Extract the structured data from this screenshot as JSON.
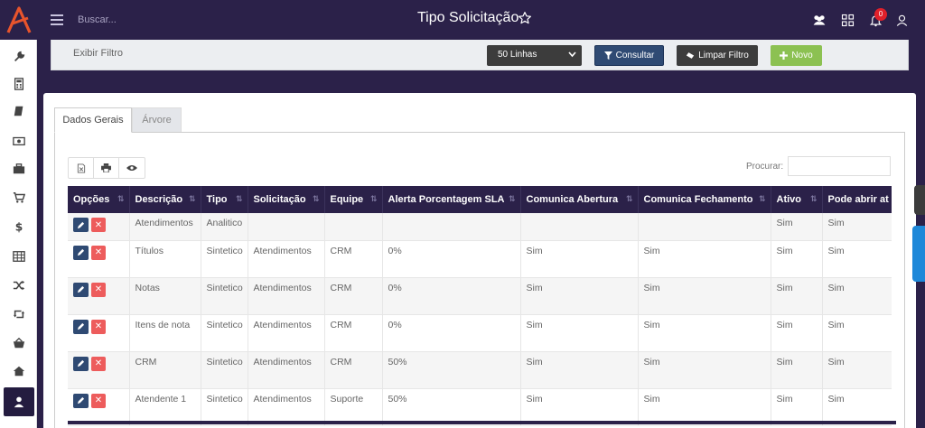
{
  "header": {
    "search_placeholder": "Buscar...",
    "page_title": "Tipo Solicitação",
    "notification_count": "0"
  },
  "sidebar": {
    "items": [
      "wrench-icon",
      "calculator-icon",
      "book-icon",
      "money-icon",
      "briefcase-icon",
      "cart-icon",
      "dollar-icon",
      "table-icon",
      "shuffle-icon",
      "retweet-icon",
      "basket-icon",
      "home-icon",
      "user-icon"
    ],
    "active": "user-icon"
  },
  "filterbar": {
    "label": "Exibir Filtro",
    "rows_select": "50 Linhas",
    "consultar": "Consultar",
    "limpar": "Limpar Filtro",
    "novo": "Novo"
  },
  "tabs": {
    "geral": "Dados Gerais",
    "arvore": "Árvore"
  },
  "table": {
    "search_label": "Procurar:",
    "columns": [
      "Opções",
      "Descrição",
      "Tipo",
      "Solicitação",
      "Equipe",
      "Alerta Porcentagem SLA",
      "Comunica Abertura",
      "Comunica Fechamento",
      "Ativo",
      "Pode abrir at"
    ],
    "rows": [
      {
        "descricao": "Atendimentos",
        "tipo": "Analitico",
        "solicitacao": "",
        "equipe": "",
        "alerta": "",
        "abertura": "",
        "fechamento": "",
        "ativo": "Sim",
        "pode": "Sim"
      },
      {
        "descricao": "Títulos",
        "tipo": "Sintetico",
        "solicitacao": "Atendimentos",
        "equipe": "CRM",
        "alerta": "0%",
        "abertura": "Sim",
        "fechamento": "Sim",
        "ativo": "Sim",
        "pode": "Sim"
      },
      {
        "descricao": "Notas",
        "tipo": "Sintetico",
        "solicitacao": "Atendimentos",
        "equipe": "CRM",
        "alerta": "0%",
        "abertura": "Sim",
        "fechamento": "Sim",
        "ativo": "Sim",
        "pode": "Sim"
      },
      {
        "descricao": "Itens de nota",
        "tipo": "Sintetico",
        "solicitacao": "Atendimentos",
        "equipe": "CRM",
        "alerta": "0%",
        "abertura": "Sim",
        "fechamento": "Sim",
        "ativo": "Sim",
        "pode": "Sim"
      },
      {
        "descricao": "CRM",
        "tipo": "Sintetico",
        "solicitacao": "Atendimentos",
        "equipe": "CRM",
        "alerta": "50%",
        "abertura": "Sim",
        "fechamento": "Sim",
        "ativo": "Sim",
        "pode": "Sim"
      },
      {
        "descricao": "Atendente 1",
        "tipo": "Sintetico",
        "solicitacao": "Atendimentos",
        "equipe": "Suporte",
        "alerta": "50%",
        "abertura": "Sim",
        "fechamento": "Sim",
        "ativo": "Sim",
        "pode": "Sim"
      }
    ]
  },
  "colors": {
    "primary": "#2b2149",
    "accent": "#e8542c",
    "edit": "#2f4a73",
    "delete": "#ed5c5c",
    "novo": "#8cc152"
  }
}
